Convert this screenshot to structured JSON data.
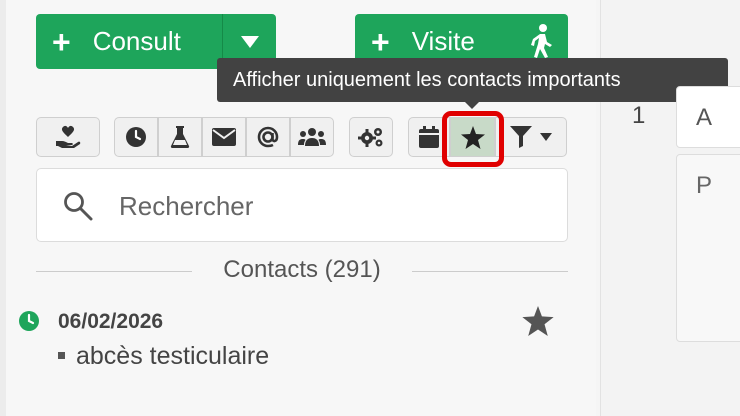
{
  "buttons": {
    "consult_label": "Consult",
    "visite_label": "Visite",
    "plus_glyph": "+"
  },
  "tooltip": {
    "text": "Afficher uniquement les contacts importants"
  },
  "toolbar": {
    "icons": [
      "hand-heart-icon",
      "clock-icon",
      "flask-icon",
      "envelope-icon",
      "at-icon",
      "users-icon",
      "gears-icon",
      "calendar-icon",
      "star-icon",
      "filter-icon",
      "caret-down-icon"
    ],
    "active": "star-icon"
  },
  "search": {
    "placeholder": "Rechercher"
  },
  "contacts": {
    "header": "Contacts (291)",
    "items": [
      {
        "date": "06/02/2026",
        "text": "abcès testiculaire",
        "icon": "clock-icon",
        "important": true
      }
    ]
  },
  "right_panel": {
    "number": "1",
    "col_a": "A",
    "col_p": "P"
  },
  "colors": {
    "green": "#1ea55b",
    "highlight": "#e00000",
    "tooltip_bg": "#424242"
  }
}
